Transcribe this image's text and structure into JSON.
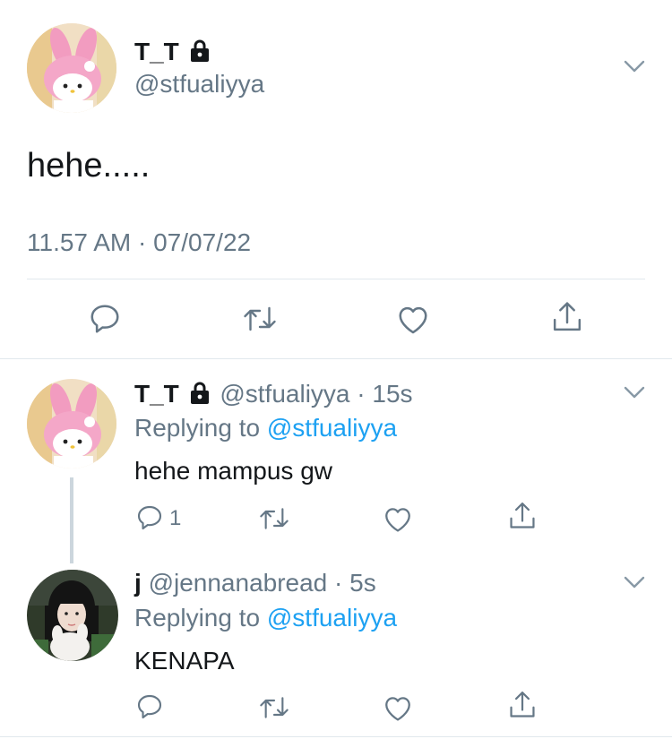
{
  "main_tweet": {
    "display_name": "T_T",
    "handle": "@stfualiyya",
    "text": "hehe.....",
    "timestamp": "11.57 AM · 07/07/22"
  },
  "replies": [
    {
      "display_name": "T_T",
      "handle": "@stfualiyya",
      "time": "· 15s",
      "replying_label": "Replying to",
      "replying_to": "@stfualiyya",
      "text": "hehe mampus gw",
      "reply_count": "1"
    },
    {
      "display_name": "j",
      "handle": "@jennanabread",
      "time": "· 5s",
      "replying_label": "Replying to",
      "replying_to": "@stfualiyya",
      "text": "KENAPA",
      "reply_count": ""
    }
  ],
  "colors": {
    "link_blue": "#1da1f2",
    "secondary_gray": "#657786",
    "icon_gray": "#657786",
    "divider": "#e1e8ed"
  },
  "icons": [
    "lock-icon",
    "chevron-down-icon",
    "reply-icon",
    "retweet-icon",
    "like-icon",
    "share-icon"
  ]
}
